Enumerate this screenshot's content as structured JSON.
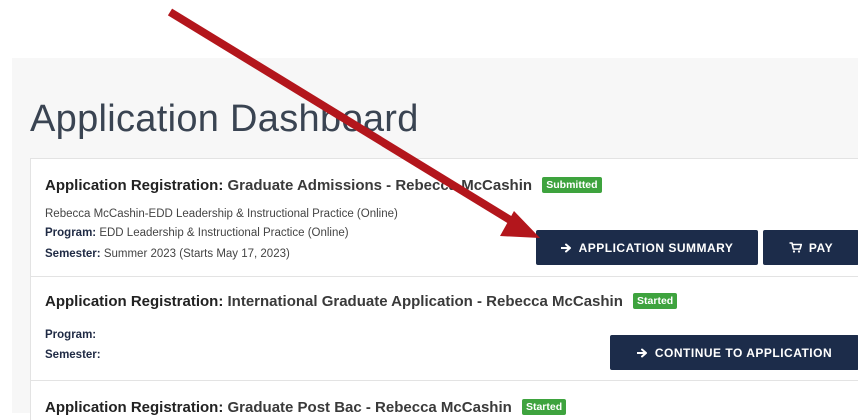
{
  "page": {
    "title": "Application Dashboard"
  },
  "applications": [
    {
      "heading_prefix": "Application Registration:",
      "heading_text": "Graduate Admissions - Rebecca McCashin",
      "status": "Submitted",
      "detail": "Rebecca McCashin-EDD Leadership & Instructional Practice (Online)",
      "program_label": "Program:",
      "program_value": "EDD Leadership & Instructional Practice (Online)",
      "semester_label": "Semester:",
      "semester_value": "Summer 2023 (Starts May 17, 2023)",
      "actions": {
        "summary_label": "APPLICATION SUMMARY",
        "pay_label": "PAY"
      }
    },
    {
      "heading_prefix": "Application Registration:",
      "heading_text": "International Graduate Application - Rebecca McCashin",
      "status": "Started",
      "program_label": "Program:",
      "semester_label": "Semester:",
      "actions": {
        "continue_label": "CONTINUE TO APPLICATION"
      }
    },
    {
      "heading_prefix": "Application Registration:",
      "heading_text": "Graduate Post Bac - Rebecca McCashin",
      "status": "Started"
    }
  ],
  "colors": {
    "button": "#1c2c4a",
    "badge": "#3ea33e",
    "annotation_arrow": "#b3161c"
  },
  "icons": {
    "arrow": "arrow-right-icon",
    "cart": "shopping-cart-icon",
    "annotation": "annotation-arrow"
  }
}
